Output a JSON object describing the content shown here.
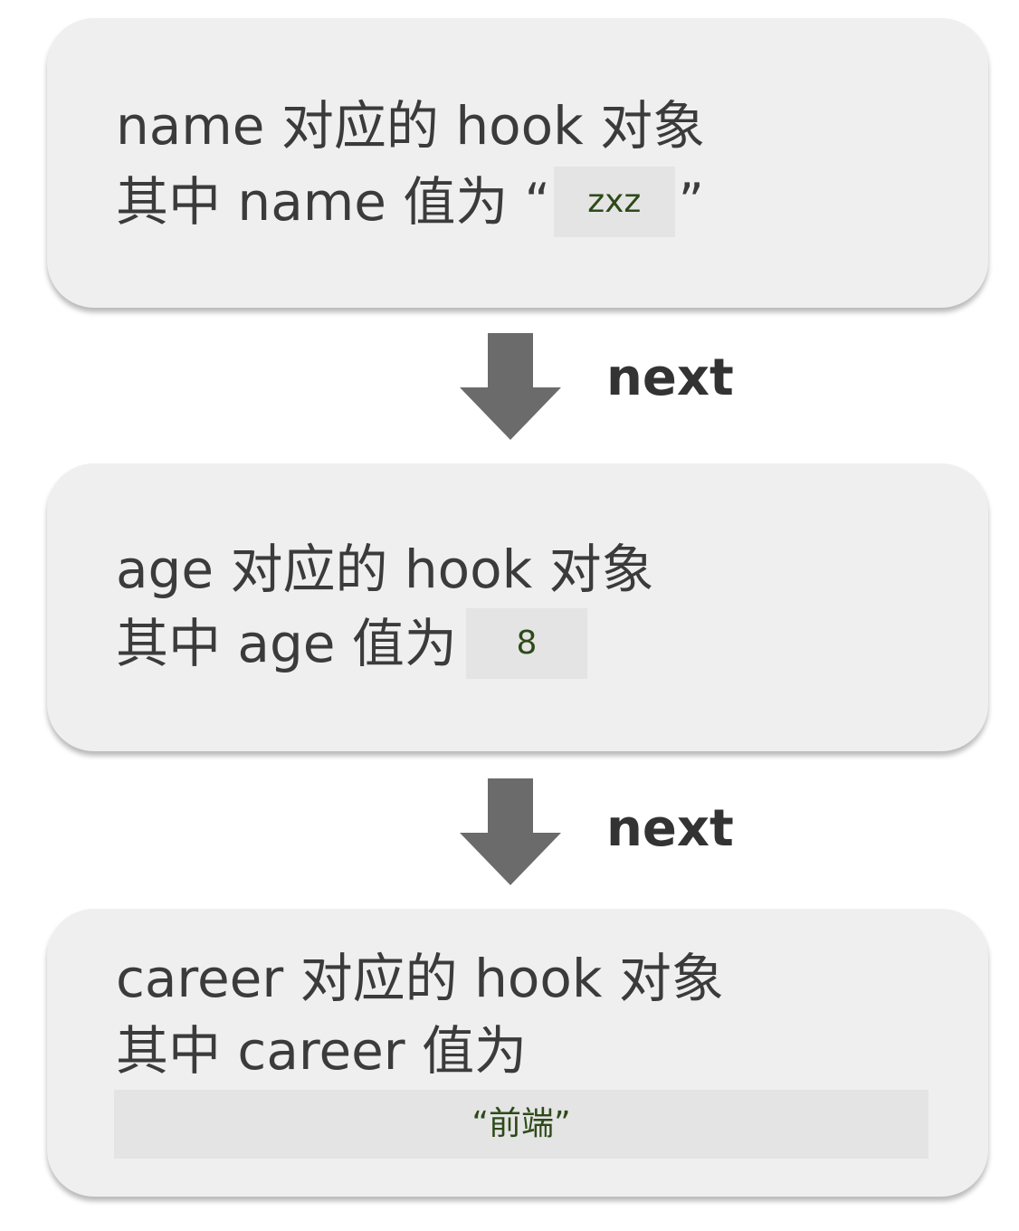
{
  "nodes": [
    {
      "line1": "name 对应的 hook 对象",
      "line2_prefix": "其中 name 值为",
      "open_quote": "“",
      "value": "zxz",
      "close_quote": "”"
    },
    {
      "line1": "age 对应的 hook 对象",
      "line2_prefix": "其中 age 值为",
      "value": "8"
    },
    {
      "line1": "career 对应的 hook 对象",
      "line2_prefix": "其中 career 值为",
      "value": "“前端”"
    }
  ],
  "links": [
    {
      "label": "next"
    },
    {
      "label": "next"
    }
  ],
  "colors": {
    "node_fill": "#efefef",
    "arrow": "#6b6b6b",
    "code_text": "#2d4a18",
    "code_bg": "#e4e4e4"
  }
}
